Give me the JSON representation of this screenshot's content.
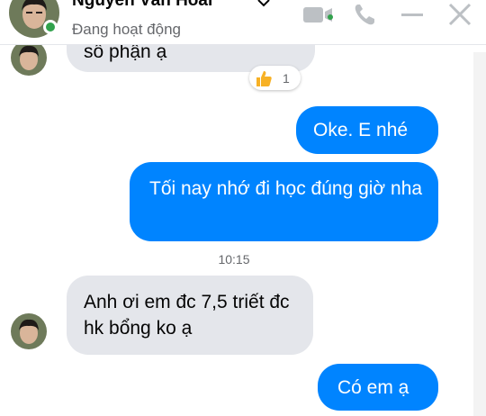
{
  "header": {
    "contact_name": "Nguyễn Văn Hoài",
    "status": "Đang hoạt động",
    "icons": [
      "avatar",
      "chevron-down-icon",
      "video-call-icon",
      "phone-icon",
      "minimize-icon",
      "close-icon"
    ]
  },
  "messages": {
    "partial_incoming": "số phận ạ",
    "reaction": {
      "emoji": "thumbs-up-icon",
      "count": "1"
    },
    "oke": "Oke. E nhé",
    "toi_nay": "Tối nay nhớ đi học đúng giờ nha",
    "timestamp": "10:15",
    "anh_oi": "Anh ơi em đc 7,5 triết đc hk bổng ko ạ",
    "co_em": "Có em ạ"
  },
  "colors": {
    "outgoing": "#0084ff",
    "incoming": "#e4e6eb",
    "online": "#31a24c",
    "icon": "#bcc0c4"
  }
}
